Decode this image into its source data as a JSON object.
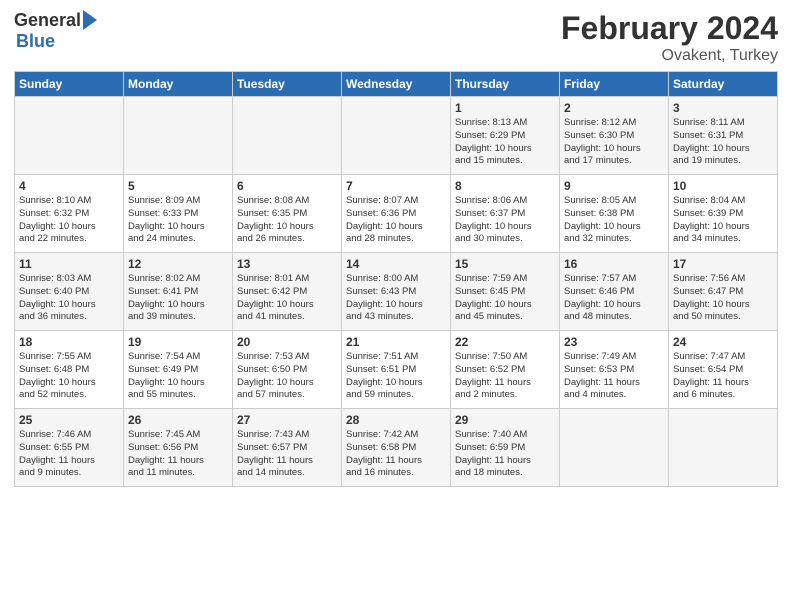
{
  "header": {
    "logo_general": "General",
    "logo_blue": "Blue",
    "main_title": "February 2024",
    "subtitle": "Ovakent, Turkey"
  },
  "days_of_week": [
    "Sunday",
    "Monday",
    "Tuesday",
    "Wednesday",
    "Thursday",
    "Friday",
    "Saturday"
  ],
  "weeks": [
    [
      {
        "date": "",
        "text": ""
      },
      {
        "date": "",
        "text": ""
      },
      {
        "date": "",
        "text": ""
      },
      {
        "date": "",
        "text": ""
      },
      {
        "date": "1",
        "text": "Sunrise: 8:13 AM\nSunset: 6:29 PM\nDaylight: 10 hours\nand 15 minutes."
      },
      {
        "date": "2",
        "text": "Sunrise: 8:12 AM\nSunset: 6:30 PM\nDaylight: 10 hours\nand 17 minutes."
      },
      {
        "date": "3",
        "text": "Sunrise: 8:11 AM\nSunset: 6:31 PM\nDaylight: 10 hours\nand 19 minutes."
      }
    ],
    [
      {
        "date": "4",
        "text": "Sunrise: 8:10 AM\nSunset: 6:32 PM\nDaylight: 10 hours\nand 22 minutes."
      },
      {
        "date": "5",
        "text": "Sunrise: 8:09 AM\nSunset: 6:33 PM\nDaylight: 10 hours\nand 24 minutes."
      },
      {
        "date": "6",
        "text": "Sunrise: 8:08 AM\nSunset: 6:35 PM\nDaylight: 10 hours\nand 26 minutes."
      },
      {
        "date": "7",
        "text": "Sunrise: 8:07 AM\nSunset: 6:36 PM\nDaylight: 10 hours\nand 28 minutes."
      },
      {
        "date": "8",
        "text": "Sunrise: 8:06 AM\nSunset: 6:37 PM\nDaylight: 10 hours\nand 30 minutes."
      },
      {
        "date": "9",
        "text": "Sunrise: 8:05 AM\nSunset: 6:38 PM\nDaylight: 10 hours\nand 32 minutes."
      },
      {
        "date": "10",
        "text": "Sunrise: 8:04 AM\nSunset: 6:39 PM\nDaylight: 10 hours\nand 34 minutes."
      }
    ],
    [
      {
        "date": "11",
        "text": "Sunrise: 8:03 AM\nSunset: 6:40 PM\nDaylight: 10 hours\nand 36 minutes."
      },
      {
        "date": "12",
        "text": "Sunrise: 8:02 AM\nSunset: 6:41 PM\nDaylight: 10 hours\nand 39 minutes."
      },
      {
        "date": "13",
        "text": "Sunrise: 8:01 AM\nSunset: 6:42 PM\nDaylight: 10 hours\nand 41 minutes."
      },
      {
        "date": "14",
        "text": "Sunrise: 8:00 AM\nSunset: 6:43 PM\nDaylight: 10 hours\nand 43 minutes."
      },
      {
        "date": "15",
        "text": "Sunrise: 7:59 AM\nSunset: 6:45 PM\nDaylight: 10 hours\nand 45 minutes."
      },
      {
        "date": "16",
        "text": "Sunrise: 7:57 AM\nSunset: 6:46 PM\nDaylight: 10 hours\nand 48 minutes."
      },
      {
        "date": "17",
        "text": "Sunrise: 7:56 AM\nSunset: 6:47 PM\nDaylight: 10 hours\nand 50 minutes."
      }
    ],
    [
      {
        "date": "18",
        "text": "Sunrise: 7:55 AM\nSunset: 6:48 PM\nDaylight: 10 hours\nand 52 minutes."
      },
      {
        "date": "19",
        "text": "Sunrise: 7:54 AM\nSunset: 6:49 PM\nDaylight: 10 hours\nand 55 minutes."
      },
      {
        "date": "20",
        "text": "Sunrise: 7:53 AM\nSunset: 6:50 PM\nDaylight: 10 hours\nand 57 minutes."
      },
      {
        "date": "21",
        "text": "Sunrise: 7:51 AM\nSunset: 6:51 PM\nDaylight: 10 hours\nand 59 minutes."
      },
      {
        "date": "22",
        "text": "Sunrise: 7:50 AM\nSunset: 6:52 PM\nDaylight: 11 hours\nand 2 minutes."
      },
      {
        "date": "23",
        "text": "Sunrise: 7:49 AM\nSunset: 6:53 PM\nDaylight: 11 hours\nand 4 minutes."
      },
      {
        "date": "24",
        "text": "Sunrise: 7:47 AM\nSunset: 6:54 PM\nDaylight: 11 hours\nand 6 minutes."
      }
    ],
    [
      {
        "date": "25",
        "text": "Sunrise: 7:46 AM\nSunset: 6:55 PM\nDaylight: 11 hours\nand 9 minutes."
      },
      {
        "date": "26",
        "text": "Sunrise: 7:45 AM\nSunset: 6:56 PM\nDaylight: 11 hours\nand 11 minutes."
      },
      {
        "date": "27",
        "text": "Sunrise: 7:43 AM\nSunset: 6:57 PM\nDaylight: 11 hours\nand 14 minutes."
      },
      {
        "date": "28",
        "text": "Sunrise: 7:42 AM\nSunset: 6:58 PM\nDaylight: 11 hours\nand 16 minutes."
      },
      {
        "date": "29",
        "text": "Sunrise: 7:40 AM\nSunset: 6:59 PM\nDaylight: 11 hours\nand 18 minutes."
      },
      {
        "date": "",
        "text": ""
      },
      {
        "date": "",
        "text": ""
      }
    ]
  ]
}
